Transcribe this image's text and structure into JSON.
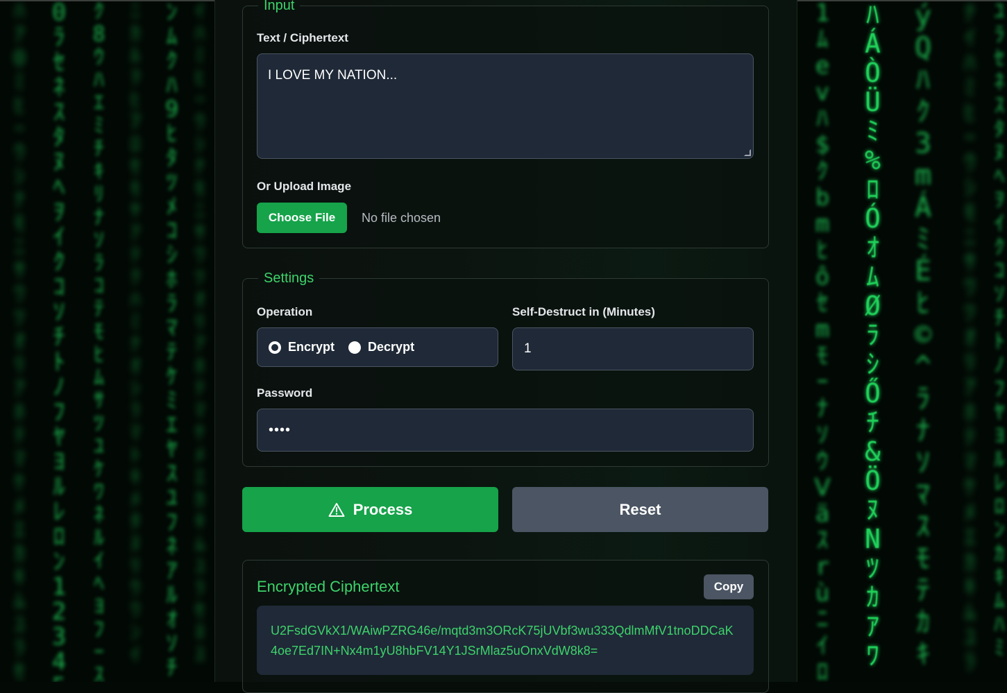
{
  "input_section": {
    "legend": "Input",
    "text_label": "Text / Ciphertext",
    "text_value": "I LOVE MY NATION...",
    "upload_label": "Or Upload Image",
    "choose_file_label": "Choose File",
    "file_status": "No file chosen"
  },
  "settings_section": {
    "legend": "Settings",
    "operation_label": "Operation",
    "operation_options": [
      {
        "label": "Encrypt",
        "checked": true
      },
      {
        "label": "Decrypt",
        "checked": false
      }
    ],
    "self_destruct_label": "Self-Destruct in (Minutes)",
    "self_destruct_value": "1",
    "password_label": "Password",
    "password_masked": "••••"
  },
  "actions": {
    "process_label": "Process",
    "process_icon": "warning-triangle-icon",
    "reset_label": "Reset"
  },
  "result": {
    "title": "Encrypted Ciphertext",
    "copy_label": "Copy",
    "ciphertext": "U2FsdGVkX1/WAiwPZRG46e/mqtd3m3ORcK75jUVbf3wu333QdlmMfV1tnoDDCaK4oe7Ed7IN+Nx4m1yU8hbFV14Y1JSrMlaz5uOnxVdW8k8="
  },
  "colors": {
    "accent_green": "#16a34a",
    "title_green": "#3ed36b",
    "field_bg": "#1f2937",
    "reset_gray": "#4b5563"
  }
}
